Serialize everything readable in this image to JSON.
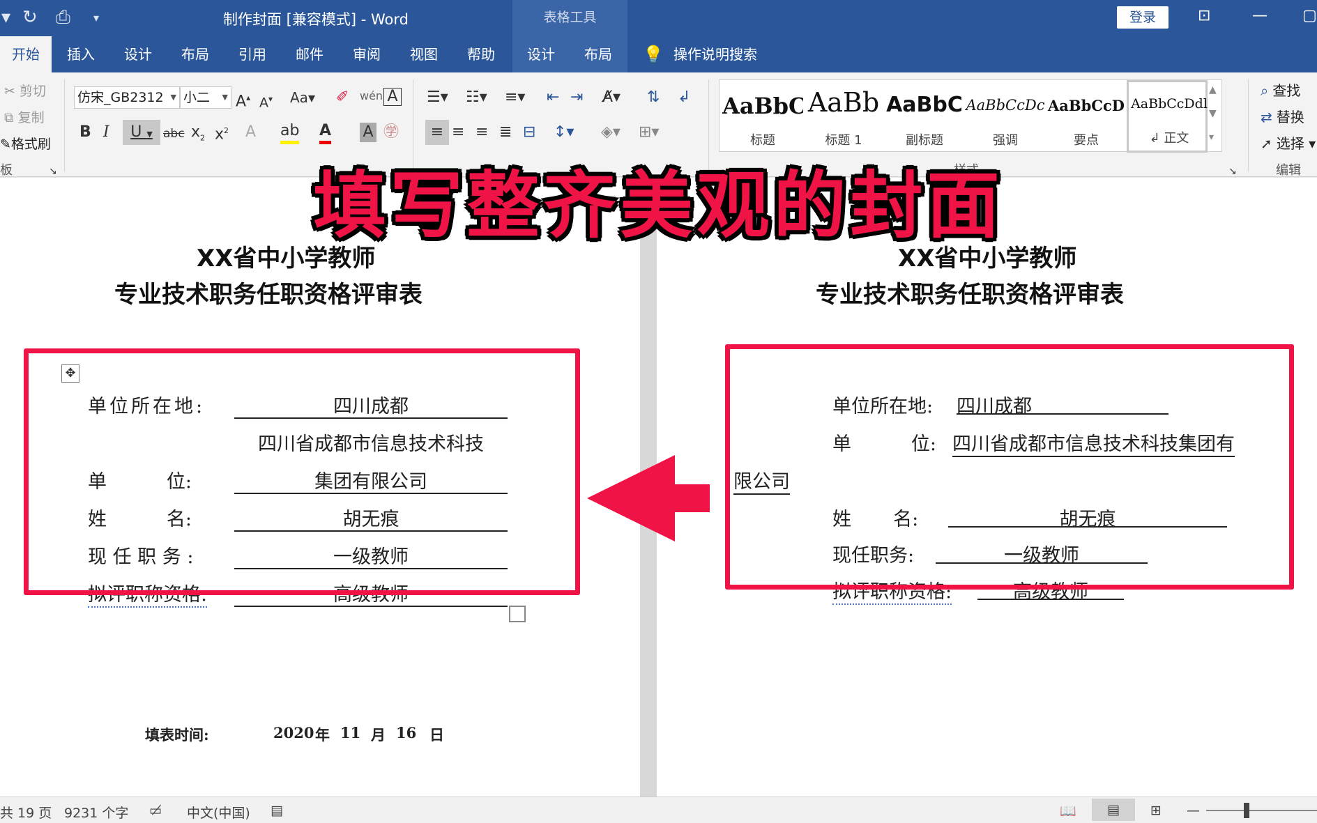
{
  "window": {
    "title": "制作封面 [兼容模式]  -  Word",
    "context_tools": "表格工具",
    "login": "登录"
  },
  "tabs": [
    "开始",
    "插入",
    "设计",
    "布局",
    "引用",
    "邮件",
    "审阅",
    "视图",
    "帮助",
    "设计",
    "布局"
  ],
  "tell_me": "操作说明搜索",
  "clipboard": {
    "cut": "剪切",
    "copy": "复制",
    "format_painter": "格式刷",
    "group_label": "板"
  },
  "font": {
    "name": "仿宋_GB2312",
    "size": "小二"
  },
  "styles": {
    "items": [
      {
        "sample": "AaBbC",
        "name": "标题"
      },
      {
        "sample": "AaBb",
        "name": "标题 1"
      },
      {
        "sample": "AaBbC",
        "name": "副标题"
      },
      {
        "sample": "AaBbCcDc",
        "name": "强调"
      },
      {
        "sample": "AaBbCcD",
        "name": "要点"
      },
      {
        "sample": "AaBbCcDdl",
        "name": "↲ 正文"
      }
    ],
    "group_label": "样式"
  },
  "editing": {
    "find": "查找",
    "replace": "替换",
    "select": "选择",
    "group_label": "编辑"
  },
  "banner": "填写整齐美观的封面",
  "left_page": {
    "heading1": "XX省中小学教师",
    "heading2": "专业技术职务任职资格评审表",
    "rows": [
      {
        "label": "单位所在地:",
        "value": "四川成都"
      },
      {
        "label": "",
        "value": "四川省成都市信息技术科技"
      },
      {
        "label": "单          位:",
        "value": "集团有限公司"
      },
      {
        "label": "姓          名:",
        "value": "胡无痕"
      },
      {
        "label": "现 任 职 务 :",
        "value": "一级教师"
      },
      {
        "label": "拟评职称资格:",
        "value": "高级教师"
      }
    ],
    "date_label": "填表时间:",
    "date": {
      "year": "2020",
      "year_unit": "年",
      "month": "11",
      "month_unit": "月",
      "day": "16",
      "day_unit": "日"
    }
  },
  "right_page": {
    "heading1": "XX省中小学教师",
    "heading2": "专业技术职务任职资格评审表",
    "loc_label": "单位所在地:",
    "loc_value": "四川成都",
    "unit_label": "单          位:",
    "unit_value_1": "四川省成都市信息技术科技集团有",
    "unit_value_2": "限公司",
    "name_label": "姓       名:",
    "name_value": "胡无痕",
    "post_label": "现任职务:",
    "post_value": "一级教师",
    "title_label": "拟评职称资格:",
    "title_value": "高级教师"
  },
  "status": {
    "pages": "共 19 页",
    "words": "9231 个字",
    "lang": "中文(中国)"
  },
  "colors": {
    "word_blue": "#2b579a",
    "highlight_red": "#f01446"
  }
}
